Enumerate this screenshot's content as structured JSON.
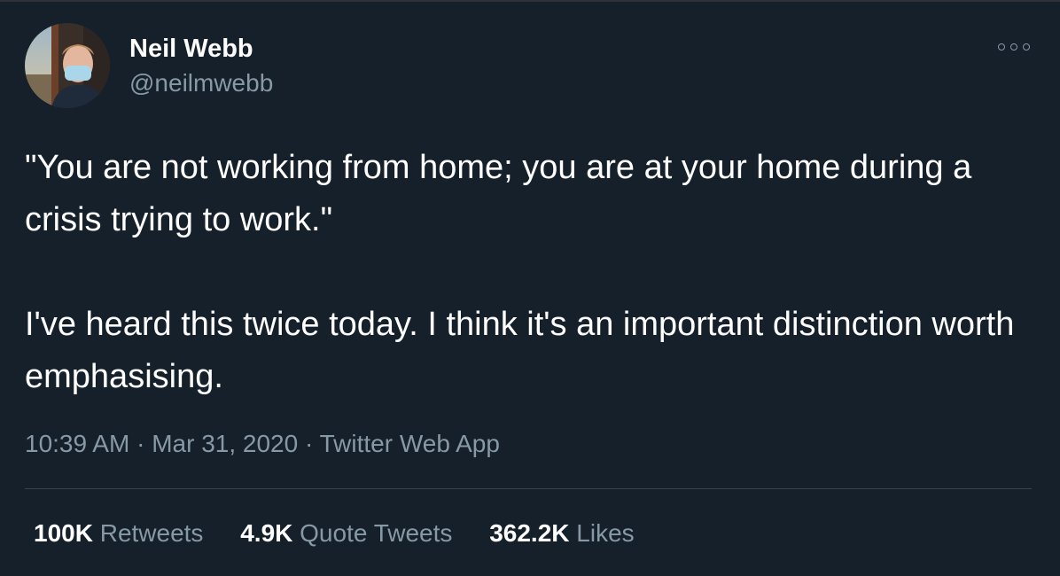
{
  "user": {
    "display_name": "Neil Webb",
    "handle": "@neilmwebb"
  },
  "tweet": {
    "paragraphs": [
      "\"You are not working from home; you are at your home during a crisis trying to work.\"",
      "I've heard this twice today. I think it's an important distinction worth emphasising."
    ],
    "time": "10:39 AM",
    "date": "Mar 31, 2020",
    "source": "Twitter Web App",
    "separator": "·"
  },
  "stats": {
    "retweets": {
      "count": "100K",
      "label": "Retweets"
    },
    "quotes": {
      "count": "4.9K",
      "label": "Quote Tweets"
    },
    "likes": {
      "count": "362.2K",
      "label": "Likes"
    }
  },
  "icons": {
    "more": "more-options-icon"
  },
  "colors": {
    "background": "#15202b",
    "text": "#ffffff",
    "secondary": "#8899a6",
    "divider": "#38444d"
  }
}
